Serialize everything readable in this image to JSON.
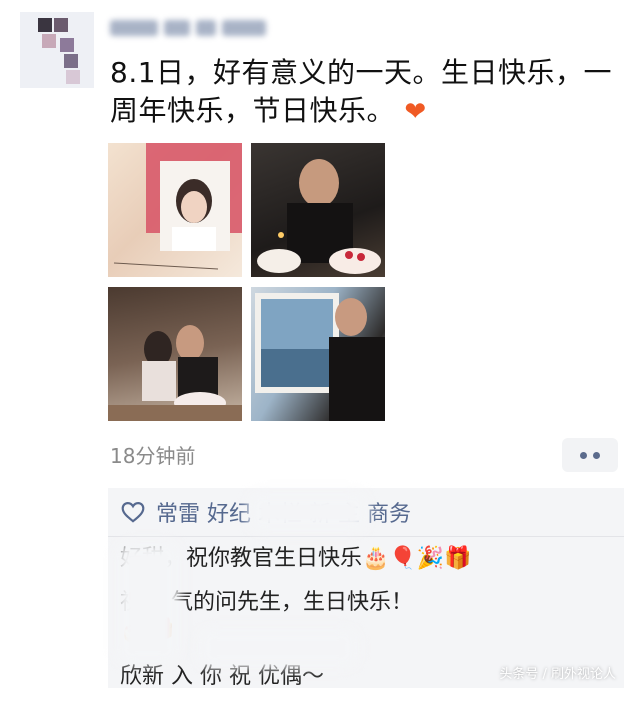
{
  "post": {
    "text_line1": "8.1日，好有意义的一天。生日快乐，一",
    "text_line2": "周年快乐，节日快乐。",
    "emoji": "❤",
    "timestamp": "18分钟前"
  },
  "likes": {
    "text": "常雷 好纪 木栏 新 主 商务"
  },
  "comments": [
    {
      "text": "好甜，祝你教官生日快乐🎂🎈🎉🎁"
    },
    {
      "text": "祝威 气的问先生，生日快乐！"
    },
    {
      "text": "🎂🎁"
    },
    {
      "text": "欣新 入 你 祝 优偶～"
    }
  ],
  "watermark": "头条号 / 刷外视论人",
  "colors": {
    "like_blue": "#56698f",
    "heart": "#f05a24",
    "panel_bg": "#f4f5f7"
  }
}
